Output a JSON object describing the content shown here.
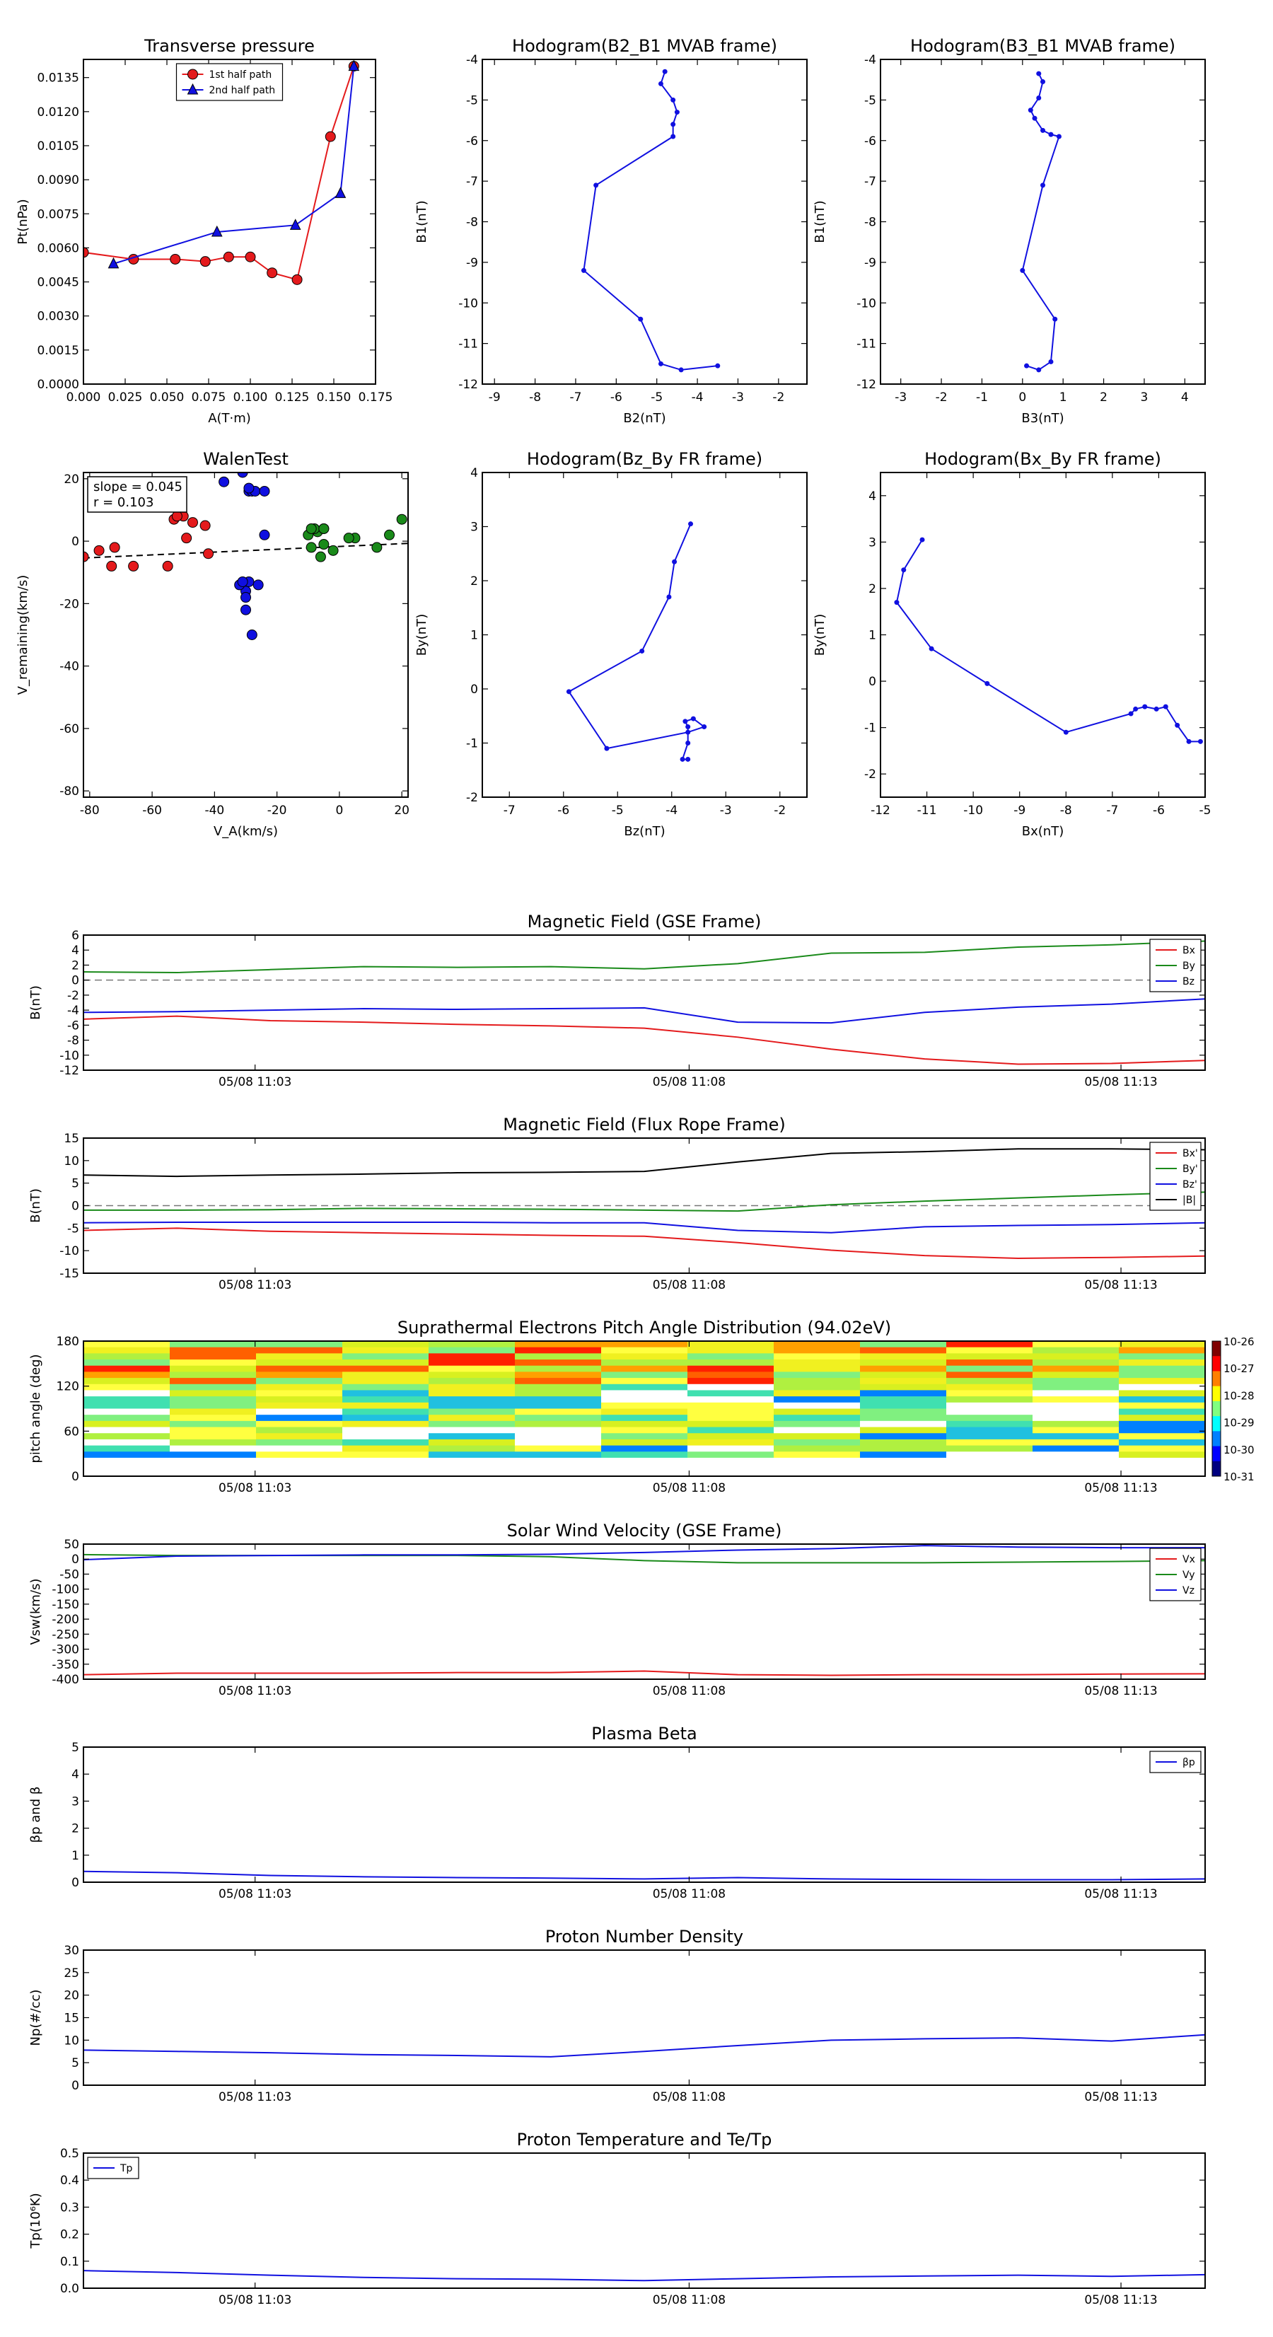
{
  "figure": {
    "timestamps": [
      "05/08 11:03",
      "05/08 11:08",
      "05/08 11:13"
    ]
  },
  "colors": {
    "red": "#e41a1c",
    "green": "#1a8a1a",
    "blue": "#1010e0",
    "black": "#000000"
  },
  "chart_data": [
    {
      "id": "pt",
      "type": "line",
      "title": "Transverse pressure",
      "xlabel": "A(T·m)",
      "ylabel": "Pt(nPa)",
      "xlim": [
        0,
        0.175
      ],
      "ylim": [
        0,
        0.0143
      ],
      "xticks": [
        "0.000",
        "0.025",
        "0.050",
        "0.075",
        "0.100",
        "0.125",
        "0.150",
        "0.175"
      ],
      "yticks": [
        "0.0000",
        "0.0015",
        "0.0030",
        "0.0045",
        "0.0060",
        "0.0075",
        "0.0090",
        "0.0105",
        "0.0120",
        "0.0135"
      ],
      "legend": "top-center",
      "series": [
        {
          "name": "1st half path",
          "color": "red",
          "marker": "circle",
          "x": [
            0.0,
            0.03,
            0.055,
            0.073,
            0.087,
            0.1,
            0.113,
            0.128,
            0.148,
            0.162
          ],
          "y": [
            0.0058,
            0.0055,
            0.0055,
            0.0054,
            0.0056,
            0.0056,
            0.0049,
            0.0046,
            0.0109,
            0.014
          ]
        },
        {
          "name": "2nd half path",
          "color": "blue",
          "marker": "triangle",
          "x": [
            0.018,
            0.08,
            0.127,
            0.154,
            0.162
          ],
          "y": [
            0.0053,
            0.0067,
            0.007,
            0.0084,
            0.014
          ]
        }
      ]
    },
    {
      "id": "h1",
      "type": "line",
      "title": "Hodogram(B2_B1 MVAB frame)",
      "xlabel": "B2(nT)",
      "ylabel": "B1(nT)",
      "xlim": [
        -9.3,
        -1.3
      ],
      "ylim": [
        -12,
        -4
      ],
      "xticks": [
        "-9",
        "-8",
        "-7",
        "-6",
        "-5",
        "-4",
        "-3",
        "-2"
      ],
      "yticks": [
        "-12",
        "-11",
        "-10",
        "-9",
        "-8",
        "-7",
        "-6",
        "-5",
        "-4"
      ],
      "series": [
        {
          "color": "blue",
          "marker": "dot",
          "x": [
            -4.8,
            -4.9,
            -4.6,
            -4.5,
            -4.6,
            -4.6,
            -6.5,
            -6.8,
            -5.4,
            -4.9,
            -4.4,
            -3.5
          ],
          "y": [
            -4.3,
            -4.6,
            -5.0,
            -5.3,
            -5.6,
            -5.9,
            -7.1,
            -9.2,
            -10.4,
            -11.5,
            -11.65,
            -11.55
          ]
        }
      ]
    },
    {
      "id": "h2",
      "type": "line",
      "title": "Hodogram(B3_B1 MVAB frame)",
      "xlabel": "B3(nT)",
      "ylabel": "B1(nT)",
      "xlim": [
        -3.5,
        4.5
      ],
      "ylim": [
        -12,
        -4
      ],
      "xticks": [
        "-3",
        "-2",
        "-1",
        "0",
        "1",
        "2",
        "3",
        "4"
      ],
      "yticks": [
        "-12",
        "-11",
        "-10",
        "-9",
        "-8",
        "-7",
        "-6",
        "-5",
        "-4"
      ],
      "series": [
        {
          "color": "blue",
          "marker": "dot",
          "x": [
            0.4,
            0.5,
            0.4,
            0.2,
            0.3,
            0.5,
            0.7,
            0.9,
            0.5,
            0.0,
            0.8,
            0.7,
            0.4,
            0.1
          ],
          "y": [
            -4.35,
            -4.55,
            -4.95,
            -5.25,
            -5.45,
            -5.75,
            -5.85,
            -5.9,
            -7.1,
            -9.2,
            -10.4,
            -11.45,
            -11.65,
            -11.55
          ]
        }
      ]
    },
    {
      "id": "walen",
      "type": "scatter",
      "title": "WalenTest",
      "xlabel": "V_A(km/s)",
      "ylabel": "V_remaining(km/s)",
      "xlim": [
        -82,
        22
      ],
      "ylim": [
        -82,
        22
      ],
      "xticks": [
        "-80",
        "-60",
        "-40",
        "-20",
        "0",
        "20"
      ],
      "yticks": [
        "-80",
        "-60",
        "-40",
        "-20",
        "0",
        "20"
      ],
      "annotations": [
        "slope = 0.045",
        "r = 0.103"
      ],
      "fit": {
        "slope": 0.045,
        "intercept": -1.7
      },
      "series": [
        {
          "color": "red",
          "marker": "circle",
          "x": [
            -82,
            -77,
            -73,
            -72,
            -66,
            -55,
            -53,
            -50,
            -52,
            -49,
            -47,
            -43,
            -55,
            -42
          ],
          "y": [
            -5,
            -3,
            -8,
            -2,
            -8,
            -8,
            7,
            8,
            8,
            1,
            6,
            5,
            12,
            -4
          ]
        },
        {
          "color": "blue",
          "marker": "circle",
          "x": [
            -31,
            -37,
            -29,
            -28,
            -27,
            -29,
            -26,
            -24,
            -30,
            -32,
            -30,
            -30,
            -28,
            -24,
            -29,
            -31
          ],
          "y": [
            22,
            19,
            16,
            16,
            16,
            -13,
            -14,
            2,
            -16,
            -14,
            -18,
            -22,
            -30,
            16,
            17,
            -13
          ]
        },
        {
          "color": "green",
          "marker": "circle",
          "x": [
            -10,
            -7,
            -5,
            -6,
            -9,
            -5,
            -2,
            5,
            -8,
            12,
            16,
            20,
            -5,
            -9,
            3
          ],
          "y": [
            2,
            3,
            4,
            -5,
            -2,
            -1,
            -3,
            1,
            4,
            -2,
            2,
            7,
            4,
            4,
            1
          ]
        }
      ]
    },
    {
      "id": "h3",
      "type": "line",
      "title": "Hodogram(Bz_By FR frame)",
      "xlabel": "Bz(nT)",
      "ylabel": "By(nT)",
      "xlim": [
        -7.5,
        -1.5
      ],
      "ylim": [
        -2,
        4
      ],
      "xticks": [
        "-7",
        "-6",
        "-5",
        "-4",
        "-3",
        "-2"
      ],
      "yticks": [
        "-2",
        "-1",
        "0",
        "1",
        "2",
        "3",
        "4"
      ],
      "series": [
        {
          "color": "blue",
          "marker": "dot",
          "x": [
            -3.65,
            -3.95,
            -4.05,
            -4.55,
            -5.9,
            -5.2,
            -3.7,
            -3.4,
            -3.6,
            -3.75,
            -3.7,
            -3.7,
            -3.8,
            -3.7
          ],
          "y": [
            3.05,
            2.35,
            1.7,
            0.7,
            -0.05,
            -1.1,
            -0.8,
            -0.7,
            -0.55,
            -0.6,
            -0.7,
            -1.0,
            -1.3,
            -1.3
          ]
        }
      ]
    },
    {
      "id": "h4",
      "type": "line",
      "title": "Hodogram(Bx_By FR frame)",
      "xlabel": "Bx(nT)",
      "ylabel": "By(nT)",
      "xlim": [
        -12,
        -5
      ],
      "ylim": [
        -2.5,
        4.5
      ],
      "xticks": [
        "-12",
        "-11",
        "-10",
        "-9",
        "-8",
        "-7",
        "-6",
        "-5"
      ],
      "yticks": [
        "-2",
        "-1",
        "0",
        "1",
        "2",
        "3",
        "4"
      ],
      "series": [
        {
          "color": "blue",
          "marker": "dot",
          "x": [
            -11.1,
            -11.5,
            -11.65,
            -10.9,
            -9.7,
            -8.0,
            -6.6,
            -6.5,
            -6.3,
            -6.05,
            -5.85,
            -5.6,
            -5.35,
            -5.1
          ],
          "y": [
            3.05,
            2.4,
            1.7,
            0.7,
            -0.05,
            -1.1,
            -0.7,
            -0.6,
            -0.55,
            -0.6,
            -0.55,
            -0.95,
            -1.3,
            -1.3
          ]
        }
      ]
    },
    {
      "id": "mag",
      "type": "line",
      "title": "Magnetic Field (GSE Frame)",
      "ylabel": "B(nT)",
      "ylim": [
        -12,
        6
      ],
      "yticks": [
        "-12",
        "-10",
        "-8",
        "-6",
        "-4",
        "-2",
        "0",
        "2",
        "4",
        "6"
      ],
      "hline": 0,
      "legend": "top-right",
      "series": [
        {
          "name": "Bx",
          "color": "red",
          "y": [
            -5.2,
            -4.8,
            -5.4,
            -5.6,
            -5.9,
            -6.1,
            -6.4,
            -7.6,
            -9.2,
            -10.5,
            -11.2,
            -11.1,
            -10.7
          ]
        },
        {
          "name": "By",
          "color": "green",
          "y": [
            1.1,
            1.0,
            1.4,
            1.8,
            1.7,
            1.8,
            1.5,
            2.2,
            3.6,
            3.7,
            4.4,
            4.7,
            5.2
          ]
        },
        {
          "name": "Bz",
          "color": "blue",
          "y": [
            -4.3,
            -4.2,
            -4.0,
            -3.8,
            -3.9,
            -3.8,
            -3.7,
            -5.6,
            -5.7,
            -4.3,
            -3.6,
            -3.2,
            -2.5
          ]
        }
      ]
    },
    {
      "id": "magfr",
      "type": "line",
      "title": "Magnetic Field (Flux Rope Frame)",
      "ylabel": "B(nT)",
      "ylim": [
        -15,
        15
      ],
      "yticks": [
        "-15",
        "-10",
        "-5",
        "0",
        "5",
        "10",
        "15"
      ],
      "hline": 0,
      "legend": "top-right",
      "series": [
        {
          "name": "Bx'",
          "color": "red",
          "y": [
            -5.5,
            -5.0,
            -5.7,
            -6.0,
            -6.3,
            -6.6,
            -6.8,
            -8.2,
            -9.9,
            -11.1,
            -11.7,
            -11.5,
            -11.2
          ]
        },
        {
          "name": "By'",
          "color": "green",
          "y": [
            -1.0,
            -1.0,
            -0.9,
            -0.6,
            -0.7,
            -0.8,
            -1.0,
            -1.2,
            0.2,
            1.0,
            1.7,
            2.4,
            3.0
          ]
        },
        {
          "name": "Bz'",
          "color": "blue",
          "y": [
            -3.8,
            -3.7,
            -3.7,
            -3.7,
            -3.7,
            -3.8,
            -3.8,
            -5.5,
            -6.0,
            -4.7,
            -4.4,
            -4.2,
            -3.8
          ]
        },
        {
          "name": "|B|",
          "color": "black",
          "y": [
            6.8,
            6.5,
            6.8,
            7.0,
            7.3,
            7.4,
            7.6,
            9.7,
            11.6,
            12.0,
            12.6,
            12.6,
            12.4
          ]
        }
      ]
    },
    {
      "id": "pad",
      "type": "heatmap",
      "title": "Suprathermal Electrons Pitch Angle Distribution (94.02eV)",
      "ylabel": "pitch angle (deg)",
      "ylim": [
        0,
        180
      ],
      "yticks": [
        "0",
        "60",
        "120",
        "180"
      ],
      "colorbar_labels": [
        "10-26",
        "10-27",
        "10-28",
        "10-29",
        "10-30",
        "10-31"
      ],
      "ncols": 13,
      "nrows": 22
    },
    {
      "id": "vsw",
      "type": "line",
      "title": "Solar Wind Velocity (GSE Frame)",
      "ylabel": "Vsw(km/s)",
      "ylim": [
        -400,
        50
      ],
      "yticks": [
        "-400",
        "-350",
        "-300",
        "-250",
        "-200",
        "-150",
        "-100",
        "-50",
        "0",
        "50"
      ],
      "legend": "top-right",
      "series": [
        {
          "name": "Vx",
          "color": "red",
          "y": [
            -385,
            -380,
            -380,
            -380,
            -378,
            -378,
            -373,
            -385,
            -387,
            -385,
            -385,
            -383,
            -382
          ]
        },
        {
          "name": "Vy",
          "color": "green",
          "y": [
            15,
            12,
            12,
            12,
            12,
            8,
            -5,
            -12,
            -12,
            -12,
            -10,
            -8,
            -5
          ]
        },
        {
          "name": "Vz",
          "color": "blue",
          "y": [
            -2,
            10,
            12,
            14,
            14,
            16,
            22,
            30,
            35,
            45,
            40,
            38,
            38
          ]
        }
      ]
    },
    {
      "id": "beta",
      "type": "line",
      "title": "Plasma Beta",
      "ylabel": "βp and β",
      "ylim": [
        0,
        5
      ],
      "yticks": [
        "0",
        "1",
        "2",
        "3",
        "4",
        "5"
      ],
      "legend": "top-right",
      "series": [
        {
          "name": "βp",
          "color": "blue",
          "y": [
            0.4,
            0.35,
            0.25,
            0.2,
            0.17,
            0.15,
            0.12,
            0.17,
            0.12,
            0.1,
            0.09,
            0.09,
            0.12
          ]
        }
      ]
    },
    {
      "id": "np",
      "type": "line",
      "title": "Proton Number Density",
      "ylabel": "Np(#/cc)",
      "ylim": [
        0,
        30
      ],
      "yticks": [
        "0",
        "5",
        "10",
        "15",
        "20",
        "25",
        "30"
      ],
      "series": [
        {
          "color": "blue",
          "y": [
            7.8,
            7.5,
            7.2,
            6.8,
            6.6,
            6.3,
            7.5,
            8.8,
            10.0,
            10.3,
            10.5,
            9.8,
            11.2
          ]
        }
      ]
    },
    {
      "id": "tp",
      "type": "line",
      "title": "Proton Temperature and Te/Tp",
      "ylabel": "Tp(10⁶K)",
      "ylim": [
        0,
        0.5
      ],
      "yticks": [
        "0.0",
        "0.1",
        "0.2",
        "0.3",
        "0.4",
        "0.5"
      ],
      "legend": "top-left",
      "series": [
        {
          "name": "Tp",
          "color": "blue",
          "y": [
            0.065,
            0.058,
            0.048,
            0.04,
            0.035,
            0.033,
            0.028,
            0.035,
            0.042,
            0.045,
            0.048,
            0.044,
            0.05
          ]
        }
      ]
    }
  ]
}
